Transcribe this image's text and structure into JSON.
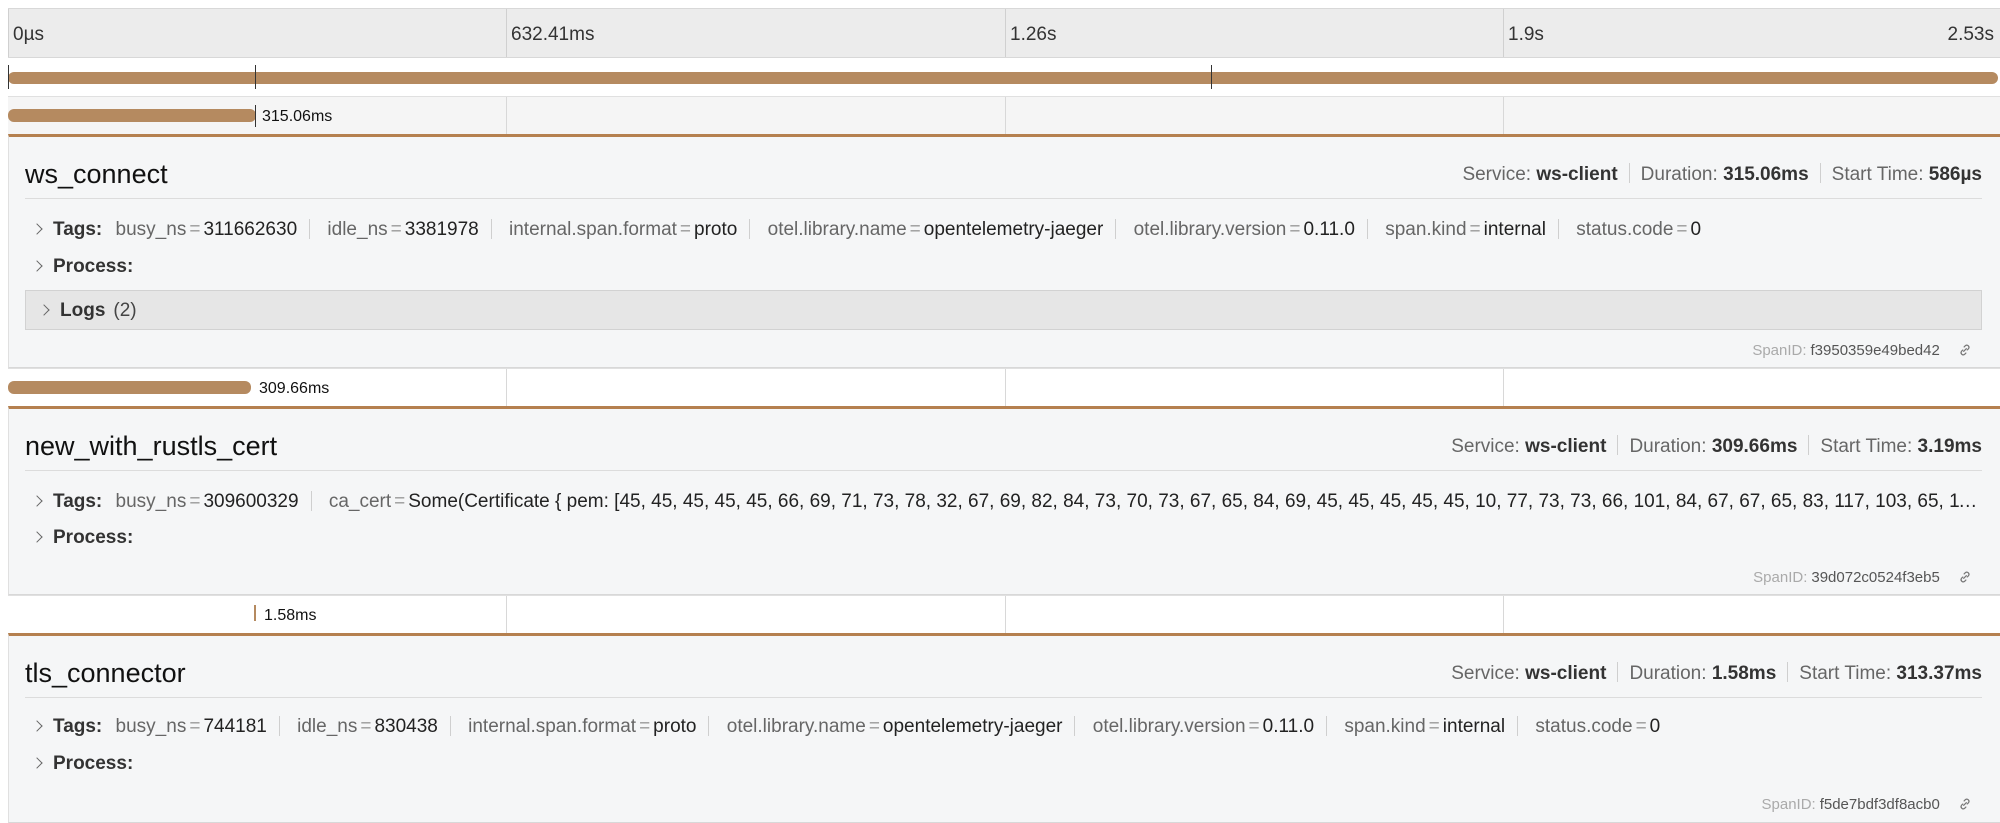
{
  "ruler": {
    "ticks": [
      "0µs",
      "632.41ms",
      "1.26s",
      "1.9s",
      "2.53s"
    ]
  },
  "spans": [
    {
      "duration_label": "315.06ms",
      "name": "ws_connect",
      "service_label": "Service:",
      "service": "ws-client",
      "duration_key": "Duration:",
      "duration": "315.06ms",
      "start_key": "Start Time:",
      "start": "586µs",
      "tags_label": "Tags:",
      "tags": [
        {
          "k": "busy_ns",
          "v": "311662630"
        },
        {
          "k": "idle_ns",
          "v": "3381978"
        },
        {
          "k": "internal.span.format",
          "v": "proto"
        },
        {
          "k": "otel.library.name",
          "v": "opentelemetry-jaeger"
        },
        {
          "k": "otel.library.version",
          "v": "0.11.0"
        },
        {
          "k": "span.kind",
          "v": "internal"
        },
        {
          "k": "status.code",
          "v": "0"
        }
      ],
      "process_label": "Process:",
      "logs_label": "Logs",
      "logs_count": "(2)",
      "spanid_label": "SpanID:",
      "spanid": "f3950359e49bed42"
    },
    {
      "duration_label": "309.66ms",
      "name": "new_with_rustls_cert",
      "service_label": "Service:",
      "service": "ws-client",
      "duration_key": "Duration:",
      "duration": "309.66ms",
      "start_key": "Start Time:",
      "start": "3.19ms",
      "tags_label": "Tags:",
      "tags": [
        {
          "k": "busy_ns",
          "v": "309600329"
        },
        {
          "k": "ca_cert",
          "v": "Some(Certificate { pem: [45, 45, 45, 45, 45, 66, 69, 71, 73, 78, 32, 67, 69, 82, 84, 73, 70, 73, 67, 65, 84, 69, 45, 45, 45, 45, 45, 10, 77, 73, 73, 66, 101, 84, 67, 67, 65, 83, 117, 103, 65, 11…"
        }
      ],
      "process_label": "Process:",
      "spanid_label": "SpanID:",
      "spanid": "39d072c0524f3eb5"
    },
    {
      "duration_label": "1.58ms",
      "name": "tls_connector",
      "service_label": "Service:",
      "service": "ws-client",
      "duration_key": "Duration:",
      "duration": "1.58ms",
      "start_key": "Start Time:",
      "start": "313.37ms",
      "tags_label": "Tags:",
      "tags": [
        {
          "k": "busy_ns",
          "v": "744181"
        },
        {
          "k": "idle_ns",
          "v": "830438"
        },
        {
          "k": "internal.span.format",
          "v": "proto"
        },
        {
          "k": "otel.library.name",
          "v": "opentelemetry-jaeger"
        },
        {
          "k": "otel.library.version",
          "v": "0.11.0"
        },
        {
          "k": "span.kind",
          "v": "internal"
        },
        {
          "k": "status.code",
          "v": "0"
        }
      ],
      "process_label": "Process:",
      "spanid_label": "SpanID:",
      "spanid": "f5de7bdf3df8acb0"
    }
  ],
  "colors": {
    "span_bar": "#b58a60",
    "detail_border": "#b5804f"
  }
}
